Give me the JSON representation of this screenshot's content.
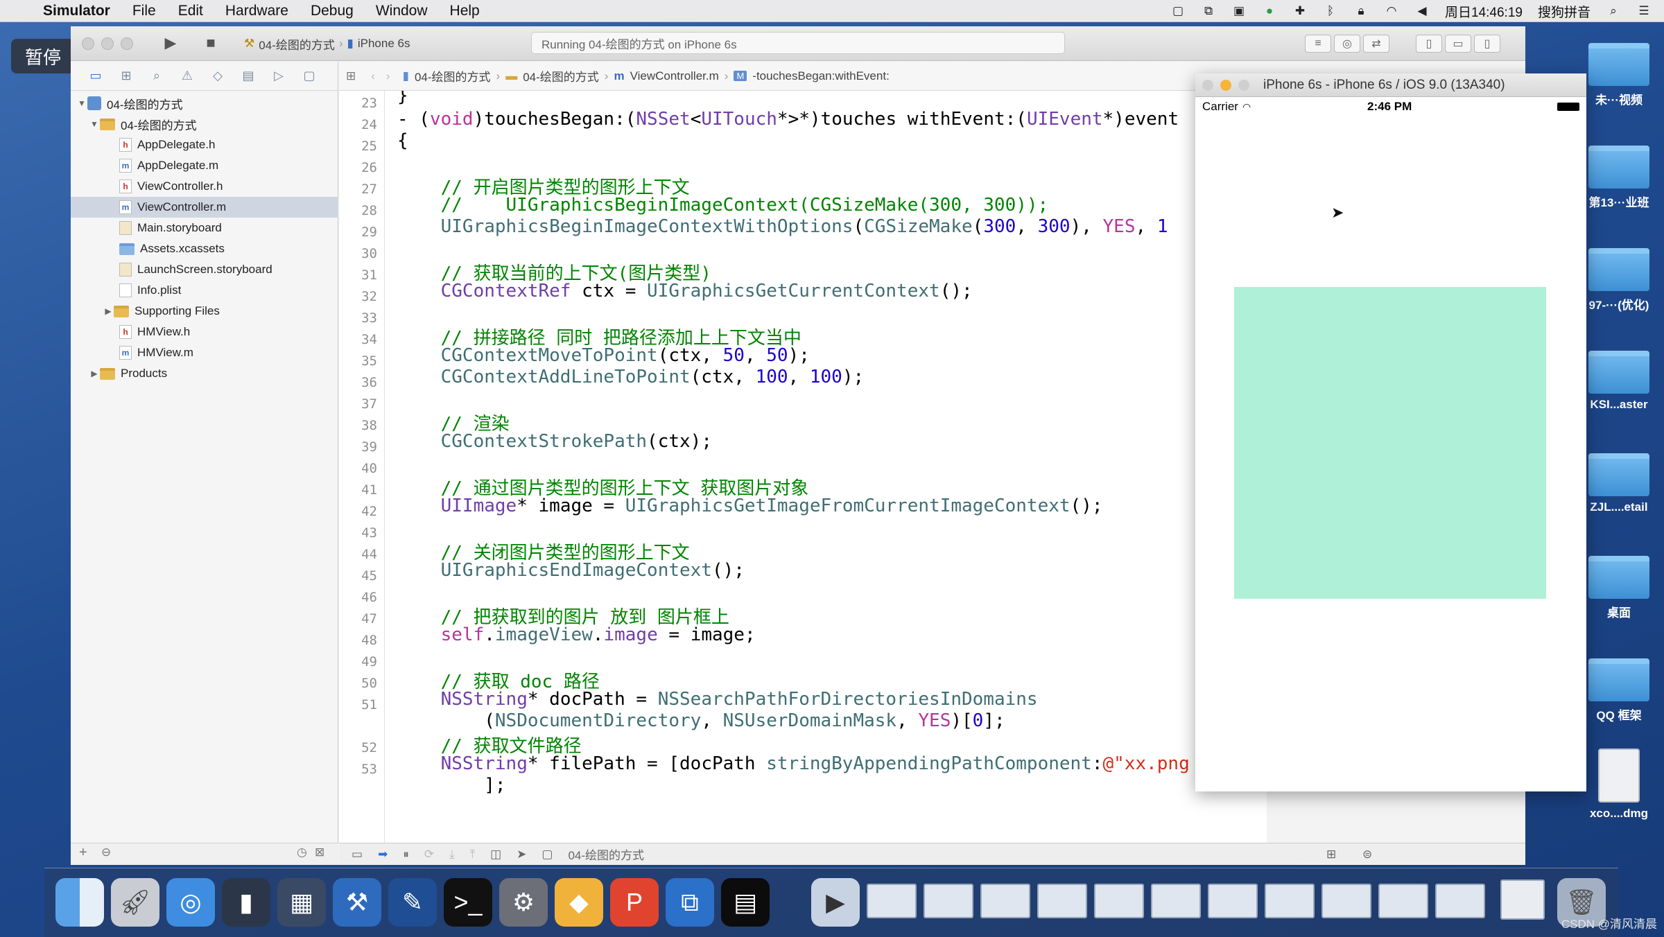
{
  "menubar": {
    "app": "Simulator",
    "items": [
      "File",
      "Edit",
      "Hardware",
      "Debug",
      "Window",
      "Help"
    ],
    "clock": "周日14:46:19",
    "input_method": "搜狗拼音"
  },
  "pause_badge": "暂停",
  "toolbar": {
    "scheme": "04-绘图的方式",
    "device": "iPhone 6s",
    "activity": "Running 04-绘图的方式 on iPhone 6s"
  },
  "navigator": {
    "project": "04-绘图的方式",
    "group": "04-绘图的方式",
    "files": [
      {
        "name": "AppDelegate.h",
        "type": "h"
      },
      {
        "name": "AppDelegate.m",
        "type": "m"
      },
      {
        "name": "ViewController.h",
        "type": "h"
      },
      {
        "name": "ViewController.m",
        "type": "m"
      },
      {
        "name": "Main.storyboard",
        "type": "storyboard"
      },
      {
        "name": "Assets.xcassets",
        "type": "folder"
      },
      {
        "name": "LaunchScreen.storyboard",
        "type": "storyboard"
      },
      {
        "name": "Info.plist",
        "type": "plist"
      },
      {
        "name": "Supporting Files",
        "type": "folder"
      },
      {
        "name": "HMView.h",
        "type": "h"
      },
      {
        "name": "HMView.m",
        "type": "m"
      }
    ],
    "products": "Products",
    "selected": "ViewController.m"
  },
  "jumpbar": {
    "crumbs": [
      "04-绘图的方式",
      "04-绘图的方式",
      "ViewController.m",
      "-touchesBegan:withEvent:"
    ]
  },
  "code": {
    "line_numbers": [
      "23",
      "24",
      "25",
      "26",
      "27",
      "28",
      "29",
      "30",
      "31",
      "32",
      "33",
      "34",
      "35",
      "36",
      "37",
      "38",
      "39",
      "40",
      "41",
      "42",
      "43",
      "44",
      "45",
      "46",
      "47",
      "48",
      "49",
      "50",
      "51",
      "",
      "52",
      "53",
      ""
    ]
  },
  "debugbar": {
    "target": "04-绘图的方式"
  },
  "simulator": {
    "title": "iPhone 6s - iPhone 6s / iOS 9.0 (13A340)",
    "carrier": "Carrier",
    "time": "2:46 PM",
    "box_color": "#aff0d8"
  },
  "desktop_icons": [
    "未···视频",
    "第13···业班",
    "97-···(优化)",
    "KSI...aster",
    "ZJL....etail",
    "桌面",
    "QQ 框架",
    "xco....dmg"
  ],
  "watermark": "CSDN @清风清晨"
}
